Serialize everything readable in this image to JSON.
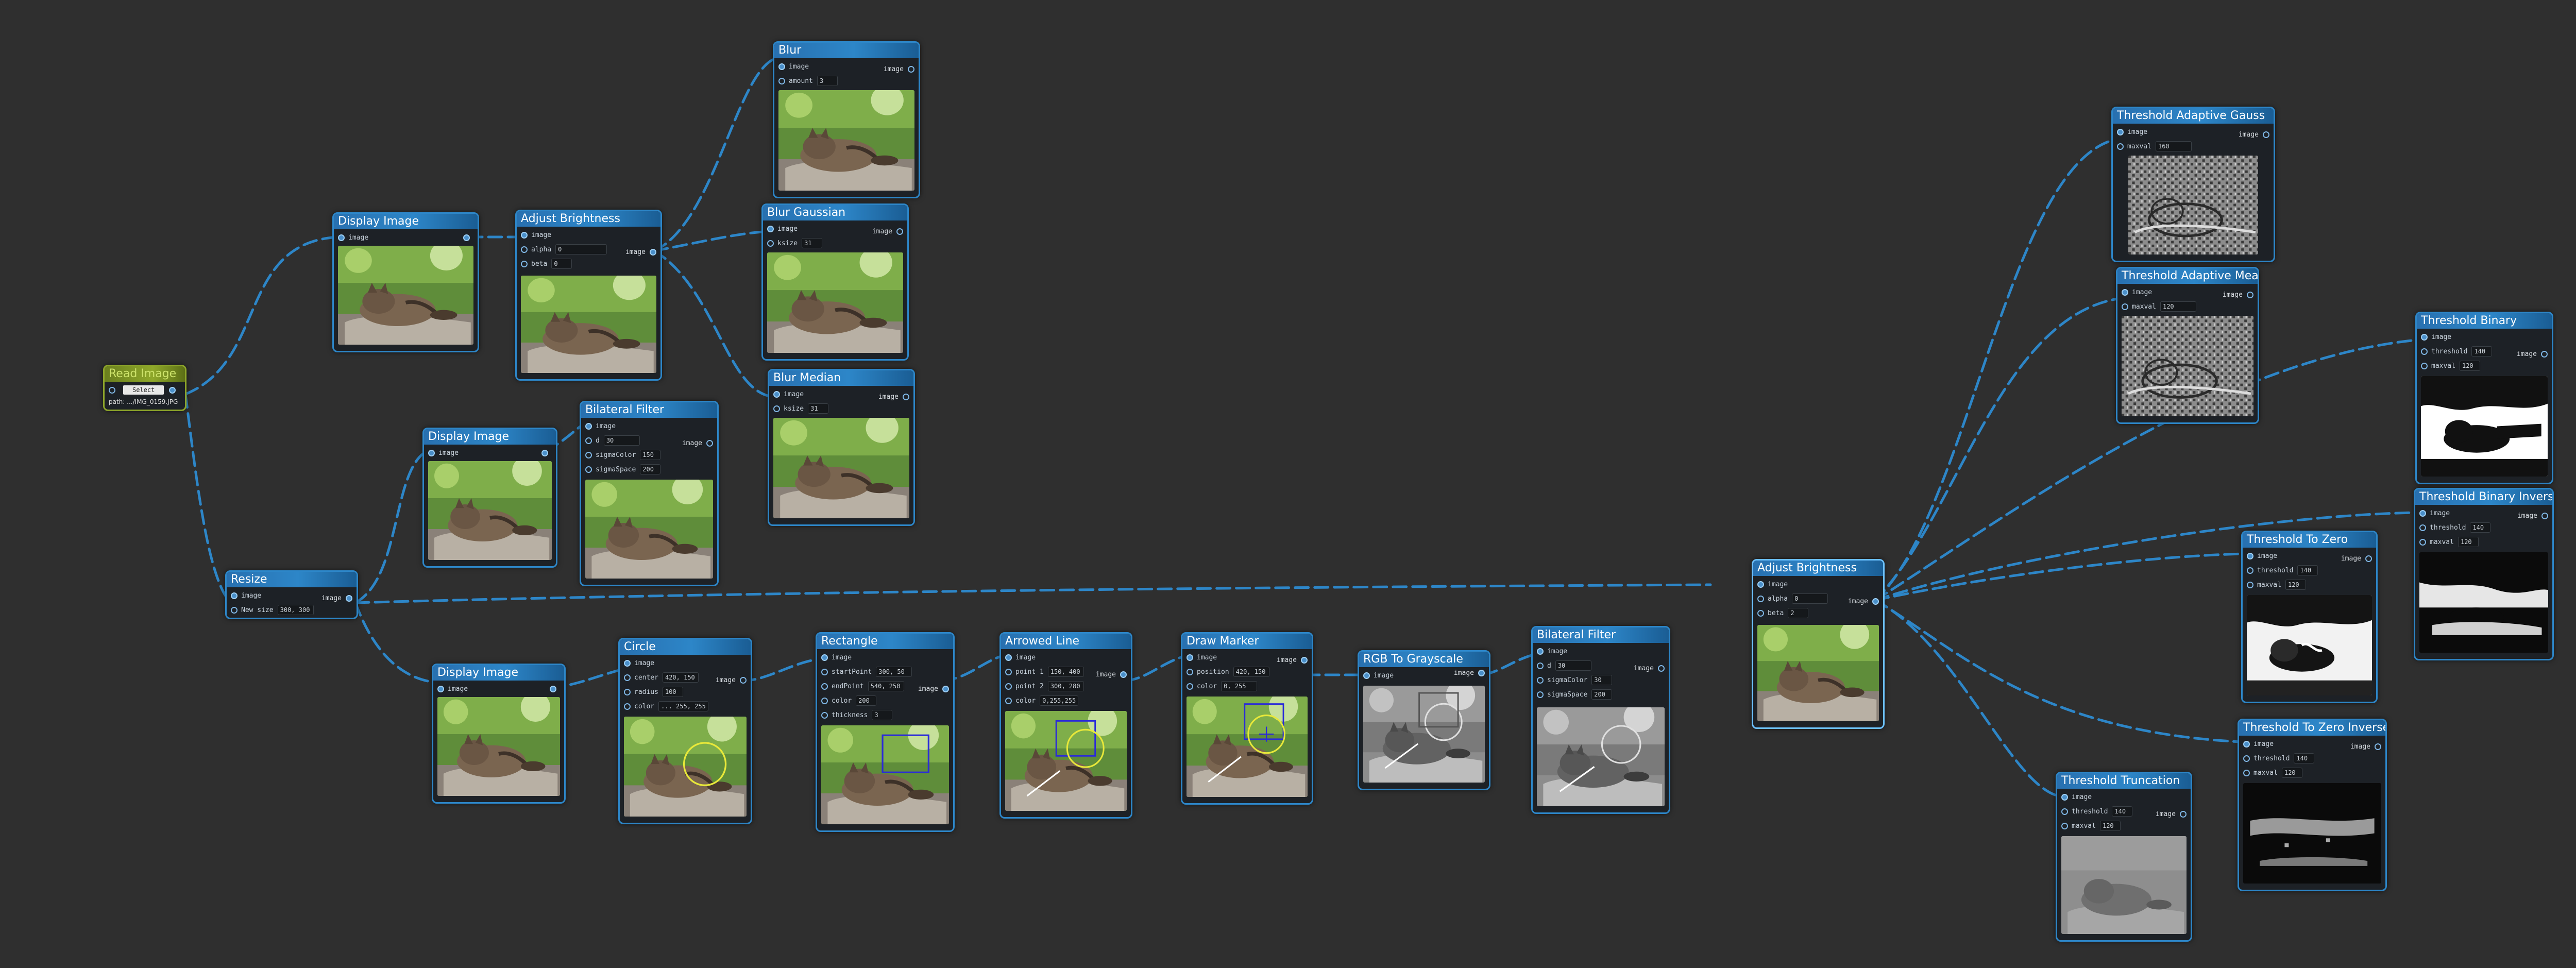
{
  "labels": {
    "image": "image",
    "alpha": "alpha",
    "beta": "beta",
    "amount": "amount",
    "ksize": "ksize",
    "d": "d",
    "sigmaColor": "sigmaColor",
    "sigmaSpace": "sigmaSpace",
    "new_size": "New size",
    "center": "center",
    "radius": "radius",
    "color": "color",
    "startPoint": "startPoint",
    "endPoint": "endPoint",
    "thickness": "thickness",
    "point1": "point 1",
    "point2": "point 2",
    "position": "position",
    "threshold": "threshold",
    "maxval": "maxval"
  },
  "nodes": {
    "read_image": {
      "title": "Read Image",
      "select_label": "Select",
      "path": "path: .../IMG_0159.JPG"
    },
    "display_1": {
      "title": "Display Image"
    },
    "display_2": {
      "title": "Display Image"
    },
    "display_3": {
      "title": "Display Image"
    },
    "adjust_1": {
      "title": "Adjust Brightness",
      "alpha": "0",
      "beta": "0"
    },
    "adjust_2": {
      "title": "Adjust Brightness",
      "alpha": "0",
      "beta": "2"
    },
    "blur": {
      "title": "Blur",
      "amount": "3"
    },
    "blur_gauss": {
      "title": "Blur Gaussian",
      "ksize": "31"
    },
    "blur_median": {
      "title": "Blur Median",
      "ksize": "31"
    },
    "bilateral_1": {
      "title": "Bilateral Filter",
      "d": "30",
      "sigmaColor": "150",
      "sigmaSpace": "200"
    },
    "bilateral_2": {
      "title": "Bilateral Filter",
      "d": "30",
      "sigmaColor": "30",
      "sigmaSpace": "200"
    },
    "resize": {
      "title": "Resize",
      "new_size": "300, 300"
    },
    "circle": {
      "title": "Circle",
      "center": "420, 150",
      "radius": "100",
      "color": "... 255, 255"
    },
    "rectangle": {
      "title": "Rectangle",
      "startPoint": "300, 50",
      "endPoint": "540, 250",
      "color": "200",
      "thickness": "3"
    },
    "arrowed_line": {
      "title": "Arrowed Line",
      "point1": "150, 400",
      "point2": "300, 280",
      "color": "0,255,255"
    },
    "draw_marker": {
      "title": "Draw Marker",
      "position": "420, 150",
      "color": "0, 255"
    },
    "rgb_gray": {
      "title": "RGB To Grayscale"
    },
    "thr_adapt_gauss": {
      "title": "Threshold Adaptive Gauss",
      "maxval": "160"
    },
    "thr_adapt_mean": {
      "title": "Threshold Adaptive Mean",
      "maxval": "120"
    },
    "thr_binary": {
      "title": "Threshold Binary",
      "threshold": "140",
      "maxval": "120"
    },
    "thr_binary_inv": {
      "title": "Threshold Binary Inverse",
      "threshold": "140",
      "maxval": "120"
    },
    "thr_tozero": {
      "title": "Threshold To Zero",
      "threshold": "140",
      "maxval": "120"
    },
    "thr_tozero_inv": {
      "title": "Threshold To Zero Inverse",
      "threshold": "140",
      "maxval": "120"
    },
    "thr_trunc": {
      "title": "Threshold Truncation",
      "threshold": "140",
      "maxval": "120"
    }
  },
  "colors": {
    "edge": "#2d86c8",
    "node_border": "#2d86c8",
    "canvas": "#2f2f2f"
  }
}
